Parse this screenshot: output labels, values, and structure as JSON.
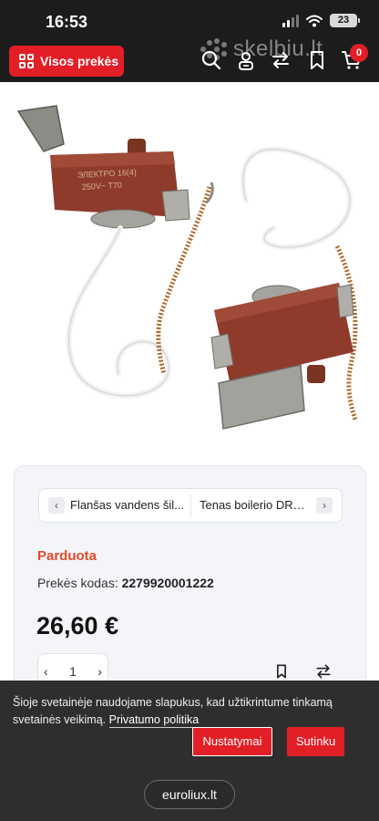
{
  "status_bar": {
    "time": "16:53",
    "battery": "23"
  },
  "header": {
    "all_products_label": "Visos prekės",
    "logo_text": "skelbiu.lt",
    "cart_count": "0",
    "icons": [
      "search-icon",
      "user-icon",
      "compare-icon",
      "bookmark-icon",
      "cart-icon"
    ]
  },
  "product": {
    "related_prev": "Flanšas vandens šil...",
    "related_next": "Tenas boilerio DRA...",
    "status": "Parduota",
    "code_label": "Prekės kodas:",
    "code_value": "2279920001222",
    "price": "26,60 €",
    "quantity": "1"
  },
  "cookie": {
    "text": "Šioje svetainėje naudojame slapukus, kad užtikrintume tinkamą svetainės veikimą.",
    "policy_link": "Privatumo politika",
    "settings_label": "Nustatymai",
    "accept_label": "Sutinku"
  },
  "browser": {
    "url": "euroliux.lt"
  },
  "colors": {
    "accent": "#e21f26",
    "sold": "#e5492a",
    "header_bg": "#1c1c1c",
    "banner_bg": "#2e2e2e"
  }
}
